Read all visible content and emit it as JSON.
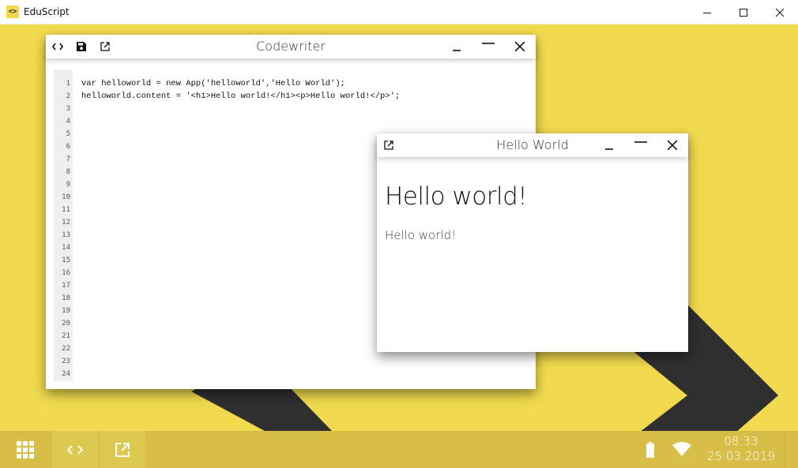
{
  "os_window": {
    "title": "EduScript",
    "app_icon_glyph": "<>",
    "icons": [
      "minimize-icon",
      "maximize-icon",
      "close-icon"
    ]
  },
  "colors": {
    "desktop_background": "#f1da4e",
    "taskbar_background": "#d7bf47",
    "chevron": "#2f2f2f",
    "window_background": "#ffffff"
  },
  "codewriter": {
    "title": "Codewriter",
    "toolbar_icons": [
      "code-icon",
      "save-icon",
      "open-external-icon"
    ],
    "line_numbers": [
      "1",
      "2",
      "3",
      "4",
      "5",
      "6",
      "7",
      "8",
      "9",
      "10",
      "11",
      "12",
      "13",
      "14",
      "15",
      "16",
      "17",
      "18",
      "19",
      "20",
      "21",
      "22",
      "23",
      "24"
    ],
    "code_lines": [
      "var helloworld = new App('helloworld','Hello World');",
      "helloworld.content = '<h1>Hello world!</h1><p>Hello world!</p>';"
    ]
  },
  "hello_world_window": {
    "title": "Hello World",
    "heading": "Hello world!",
    "paragraph": "Hello world!"
  },
  "taskbar": {
    "buttons": [
      "apps-grid-icon",
      "code-icon",
      "open-external-icon"
    ],
    "time": "08:33",
    "date": "25.03.2019",
    "status_icons": [
      "battery-icon",
      "wifi-icon"
    ]
  }
}
